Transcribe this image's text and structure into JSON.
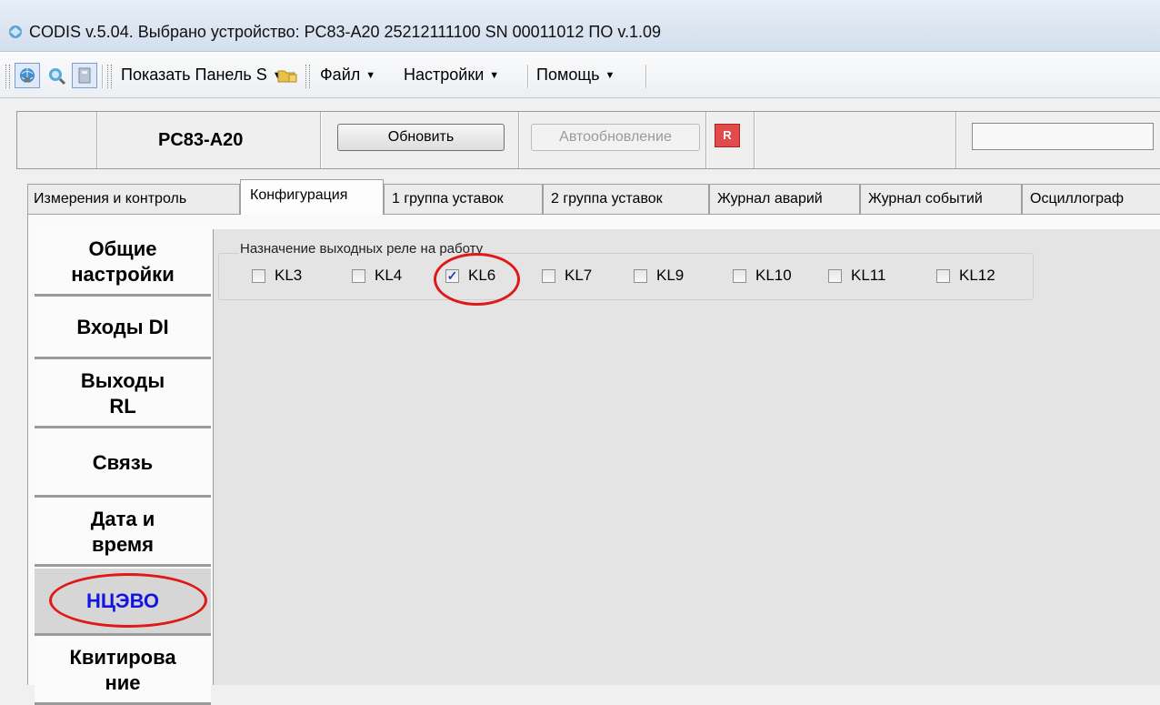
{
  "window": {
    "title": "CODIS v.5.04.  Выбрано устройство:  РС83-А20  25212111100  SN 00011012  ПО v.1.09"
  },
  "toolbar": {
    "icons": [
      "network-globe-icon",
      "search-globe-icon",
      "device-icon"
    ],
    "show_panel_label": "Показать Панель S",
    "menus": [
      {
        "label": "Файл"
      },
      {
        "label": "Настройки"
      },
      {
        "label": "Помощь"
      }
    ]
  },
  "device_panel": {
    "device_name": "PC83-A20",
    "refresh_label": "Обновить",
    "autorefresh_label": "Автообновление",
    "indicator_color": "#e24b4b"
  },
  "tabs": [
    {
      "label": "Измерения и контроль",
      "active": false
    },
    {
      "label": "Конфигурация",
      "active": true
    },
    {
      "label": "1 группа уставок",
      "active": false
    },
    {
      "label": "2 группа уставок",
      "active": false
    },
    {
      "label": "Журнал аварий",
      "active": false
    },
    {
      "label": "Журнал событий",
      "active": false
    },
    {
      "label": "Осциллограф",
      "active": false
    }
  ],
  "sidebar": {
    "items": [
      {
        "label": "Общие\nнастройки",
        "selected": false
      },
      {
        "label": "Входы DI",
        "selected": false
      },
      {
        "label": "Выходы\nRL",
        "selected": false
      },
      {
        "label": "Связь",
        "selected": false
      },
      {
        "label": "Дата и\nвремя",
        "selected": false
      },
      {
        "label": "НЦЭВО",
        "selected": true
      },
      {
        "label": "Квитирова\nние",
        "selected": false
      }
    ]
  },
  "relay_group": {
    "legend": "Назначение выходных реле на работу",
    "relays": [
      {
        "label": "KL3",
        "checked": false
      },
      {
        "label": "KL4",
        "checked": false
      },
      {
        "label": "KL6",
        "checked": true
      },
      {
        "label": "KL7",
        "checked": false
      },
      {
        "label": "KL9",
        "checked": false
      },
      {
        "label": "KL10",
        "checked": false
      },
      {
        "label": "KL11",
        "checked": false
      },
      {
        "label": "KL12",
        "checked": false
      }
    ]
  },
  "annotations": {
    "highlight_color": "#e01818"
  }
}
